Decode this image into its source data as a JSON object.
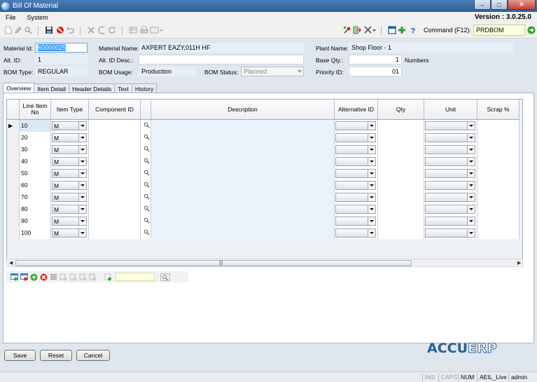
{
  "window": {
    "title": "Bill Of Material",
    "version": "Version : 3.0.25.0"
  },
  "menu": [
    "File",
    "System"
  ],
  "command": {
    "label": "Command (F12):",
    "value": "PRDBOM"
  },
  "form": {
    "material_id_label": "Material Id:",
    "material_id": "60000025",
    "material_name_label": "Material Name:",
    "material_name": "AXPERT EAZY,011H HF",
    "plant_name_label": "Plant Name:",
    "plant_name": "Shop Floor - 1",
    "alt_id_label": "Alt. ID:",
    "alt_id": "1",
    "alt_id_desc_label": "Alt. ID Desc.:",
    "alt_id_desc": "",
    "base_qty_label": "Base Qty.:",
    "base_qty": "1",
    "base_qty_unit": "Numbers",
    "bom_type_label": "BOM Type:",
    "bom_type": "REGULAR",
    "bom_usage_label": "BOM Usage:",
    "bom_usage": "Production",
    "bom_status_label": "BOM Status:",
    "bom_status": "Planned",
    "priority_id_label": "Priority ID:",
    "priority_id": "01"
  },
  "tabs": [
    {
      "label": "Overview",
      "active": true
    },
    {
      "label": "Item Detail",
      "active": false
    },
    {
      "label": "Header Details",
      "active": false
    },
    {
      "label": "Text",
      "active": false
    },
    {
      "label": "History",
      "active": false
    }
  ],
  "grid": {
    "columns": {
      "line_item": "Line Item No",
      "item_type": "Item Type",
      "component_id": "Component ID",
      "description": "Description",
      "alternative_id": "Alternative ID",
      "qty": "Qty",
      "unit": "Unit",
      "scrap": "Scrap %"
    },
    "rows": [
      {
        "line": "10",
        "type": "M"
      },
      {
        "line": "20",
        "type": "M"
      },
      {
        "line": "30",
        "type": "M"
      },
      {
        "line": "40",
        "type": "M"
      },
      {
        "line": "50",
        "type": "M"
      },
      {
        "line": "60",
        "type": "M"
      },
      {
        "line": "70",
        "type": "M"
      },
      {
        "line": "80",
        "type": "M"
      },
      {
        "line": "90",
        "type": "M"
      },
      {
        "line": "100",
        "type": "M"
      }
    ]
  },
  "buttons": {
    "save": "Save",
    "reset": "Reset",
    "cancel": "Cancel"
  },
  "logo": {
    "part1": "ACCU",
    "part2": "ERP"
  },
  "status": {
    "ins": "INS",
    "caps": "CAPS",
    "num": "NUM",
    "db": "AEIL_Live",
    "user": "admin"
  }
}
